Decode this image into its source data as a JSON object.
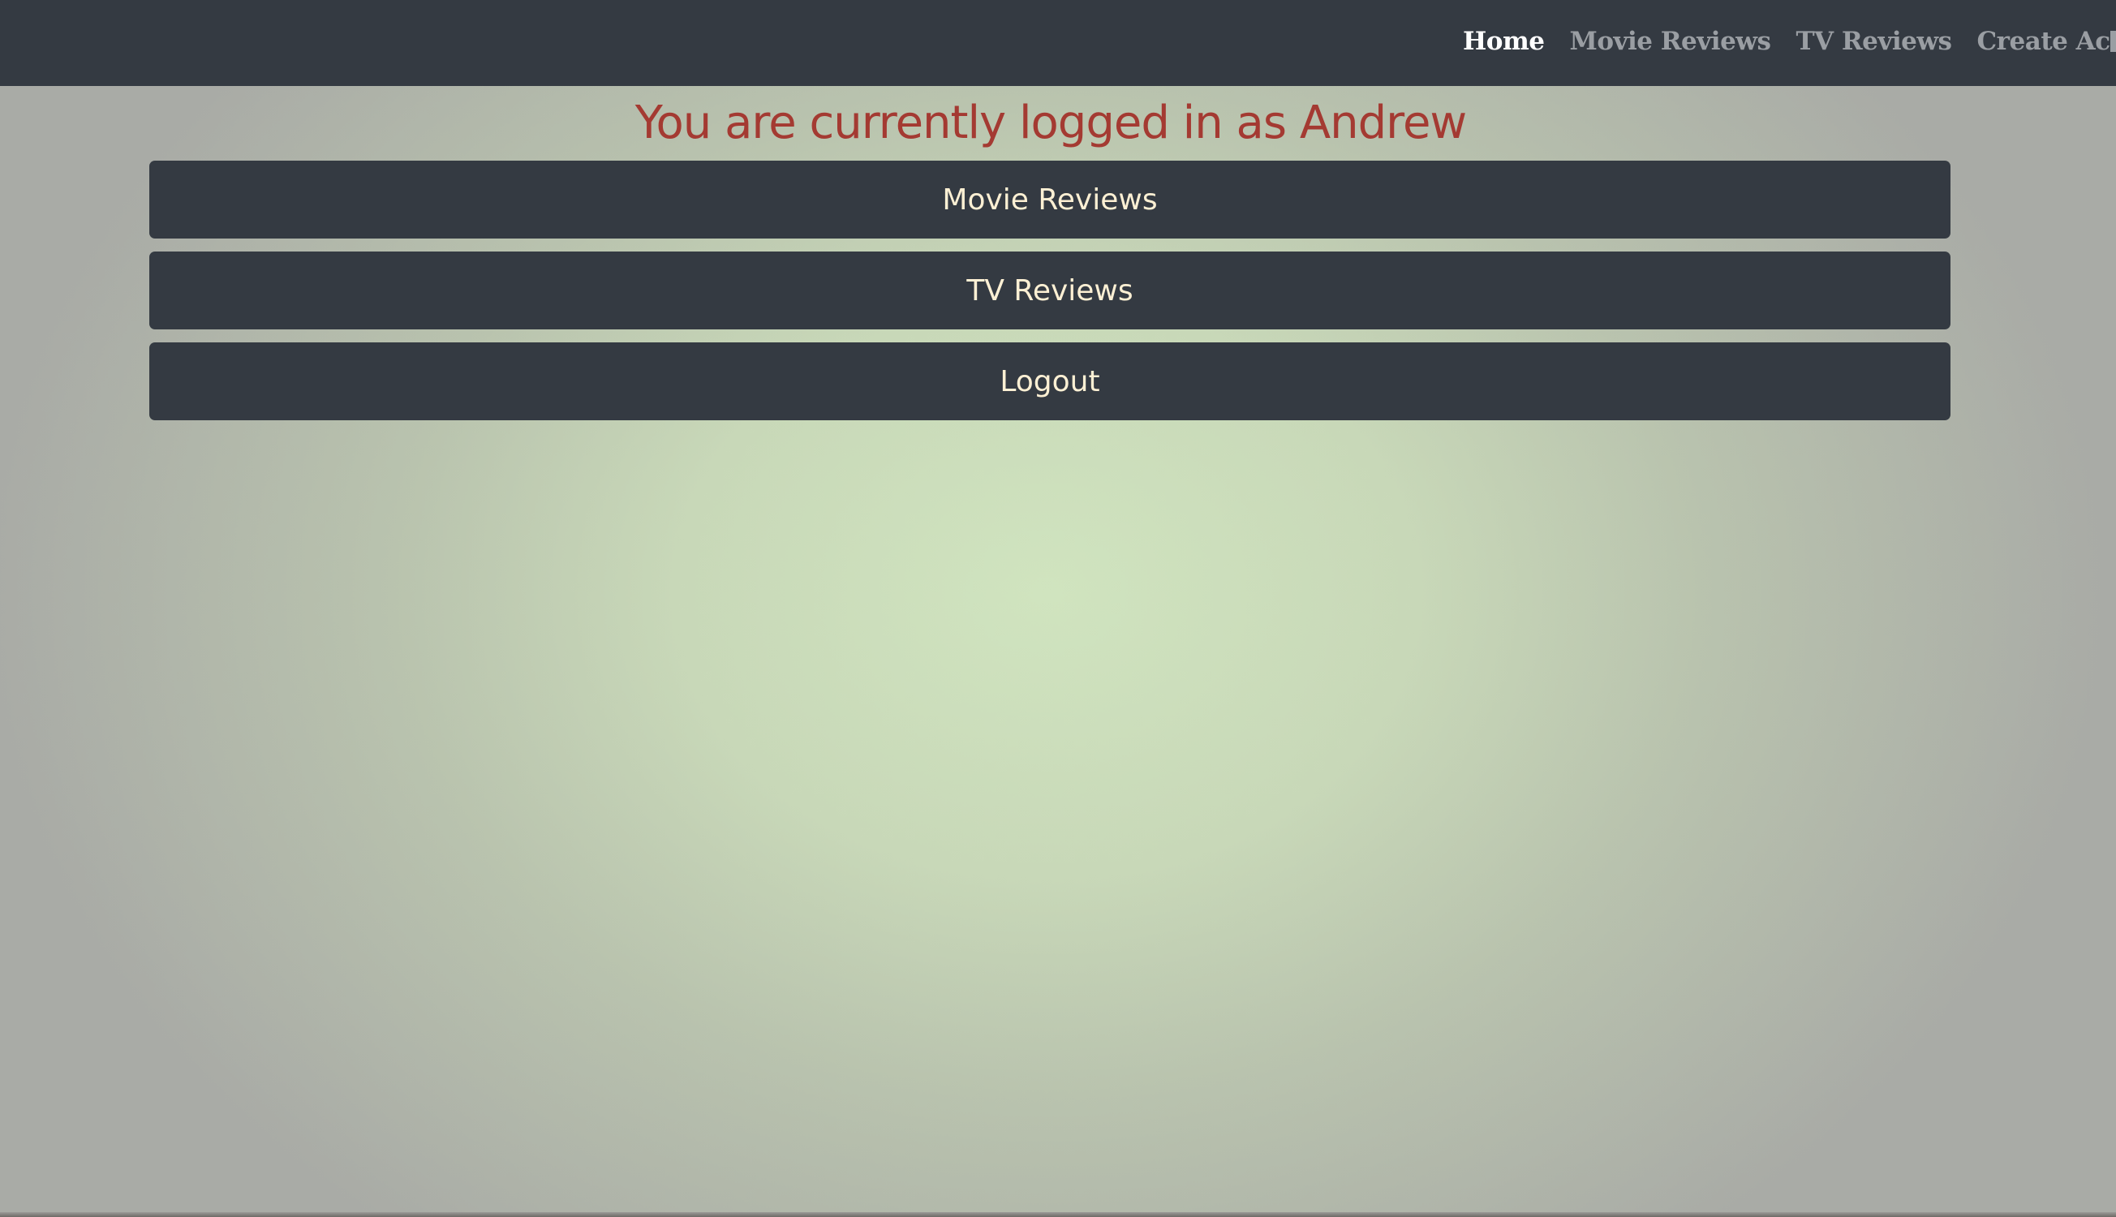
{
  "nav": {
    "items": [
      {
        "label": "Home",
        "active": true
      },
      {
        "label": "Movie Reviews",
        "active": false
      },
      {
        "label": "TV Reviews",
        "active": false
      },
      {
        "label": "Create Account",
        "active": false
      }
    ]
  },
  "main": {
    "heading": "You are currently logged in as Andrew",
    "buttons": {
      "movie_reviews": "Movie Reviews",
      "tv_reviews": "TV Reviews",
      "logout": "Logout"
    }
  },
  "colors": {
    "navbar_bg": "#343a42",
    "nav_active": "#ffffff",
    "nav_inactive": "#9a9ea3",
    "heading": "#a43a32",
    "button_bg": "#343a42",
    "button_text": "#fdf0d4",
    "background_center": "#d0e4bf",
    "background_edge": "#a9aba6"
  }
}
